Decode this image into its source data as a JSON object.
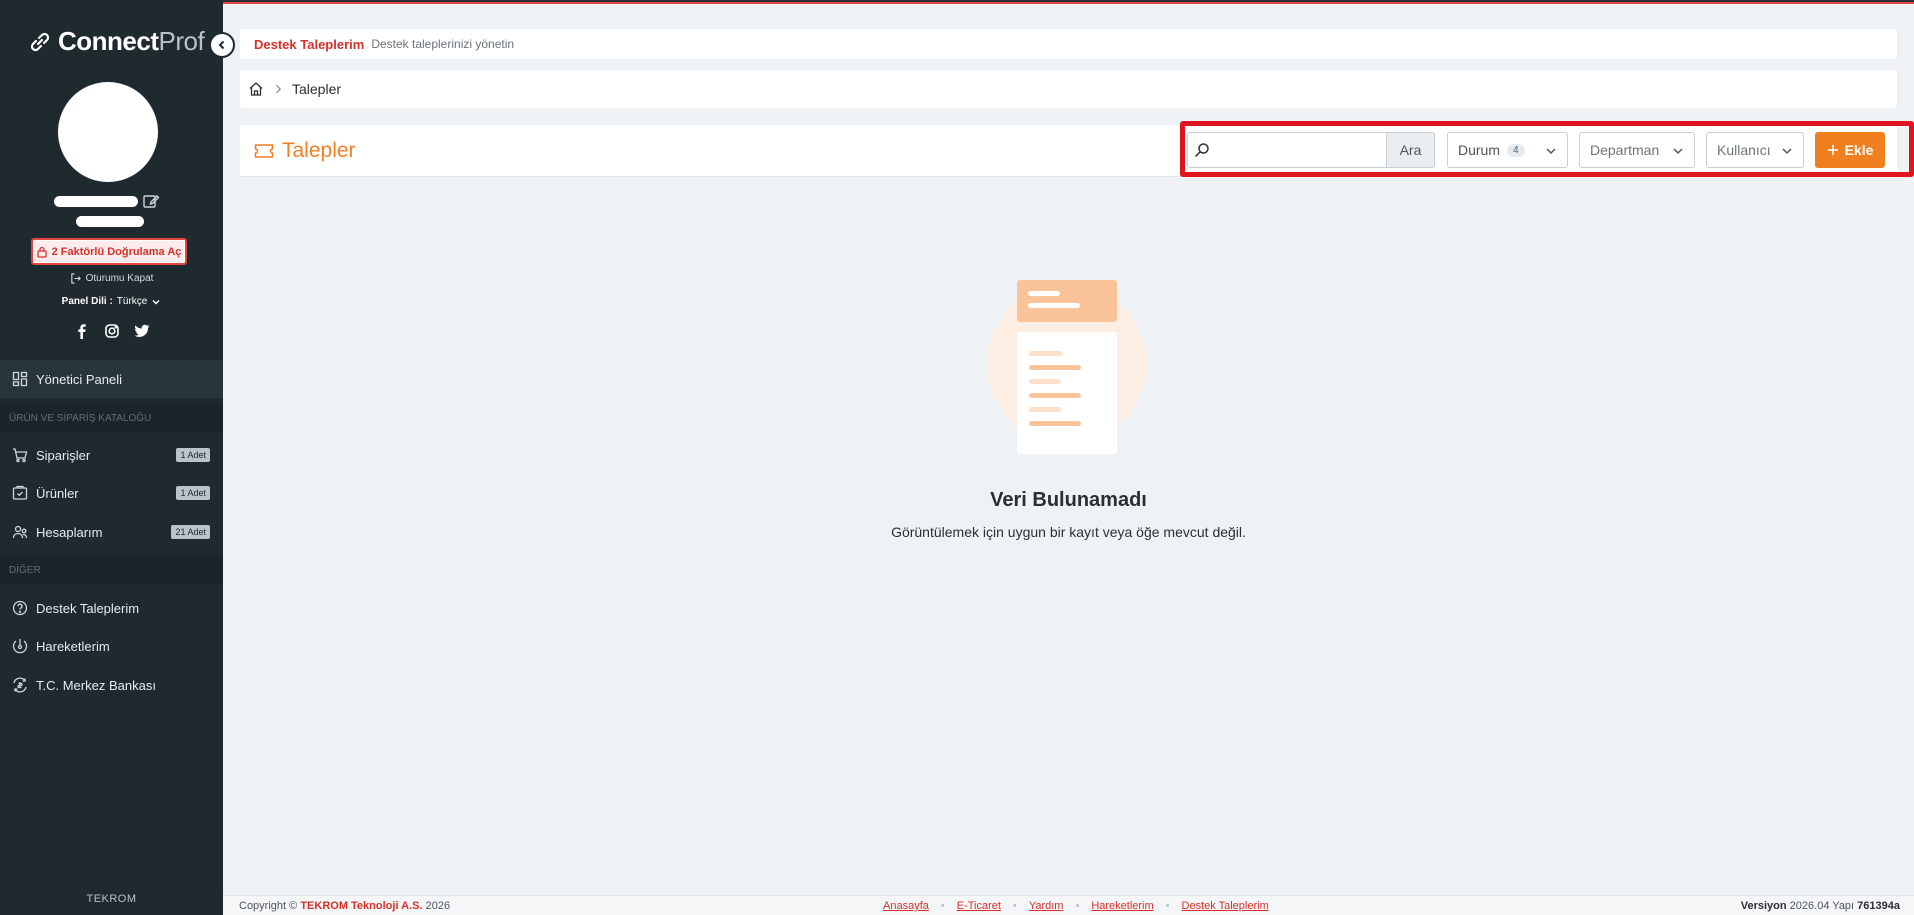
{
  "brand": {
    "bold": "Connect",
    "light": "Prof",
    "footer": "TEKROM"
  },
  "profile": {
    "twofa_label": "2 Faktörlü Doğrulama Aç",
    "logout_label": "Oturumu Kapat",
    "lang_label": "Panel Dili :",
    "lang_value": "Türkçe"
  },
  "sidebar": {
    "dashboard": "Yönetici Paneli",
    "section_catalog": "ÜRÜN VE SİPARİŞ KATALOĞU",
    "orders": {
      "label": "Siparişler",
      "badge": "1 Adet"
    },
    "products": {
      "label": "Ürünler",
      "badge": "1 Adet"
    },
    "accounts": {
      "label": "Hesaplarım",
      "badge": "21 Adet"
    },
    "section_other": "DİĞER",
    "support": "Destek Taleplerim",
    "activity": "Hareketlerim",
    "bank": "T.C. Merkez Bankası"
  },
  "header": {
    "title": "Destek Taleplerim",
    "subtitle": "Destek taleplerinizi yönetin"
  },
  "breadcrumb": {
    "current": "Talepler"
  },
  "panel": {
    "title": "Talepler",
    "search_placeholder": "",
    "search_button": "Ara",
    "status_filter": {
      "label": "Durum",
      "count": "4"
    },
    "department_filter": "Departman",
    "user_filter": "Kullanıcı",
    "add_button": "Ekle"
  },
  "empty": {
    "title": "Veri Bulunamadı",
    "subtitle": "Görüntülemek için uygun bir kayıt veya öğe mevcut değil."
  },
  "footer": {
    "copyright_prefix": "Copyright ©",
    "company": "TEKROM Teknoloji A.S.",
    "year": "2026",
    "links": [
      "Anasayfa",
      "E-Ticaret",
      "Yardım",
      "Hareketlerim",
      "Destek Taleplerim"
    ],
    "version_label": "Versiyon",
    "version": "2026.04",
    "build_label": "Yapı",
    "build": "761394a"
  },
  "colors": {
    "accent": "#f07f1f",
    "brand_red": "#d7312b",
    "sidebar_bg": "#1f2a2f",
    "highlight": "#e0141e"
  }
}
